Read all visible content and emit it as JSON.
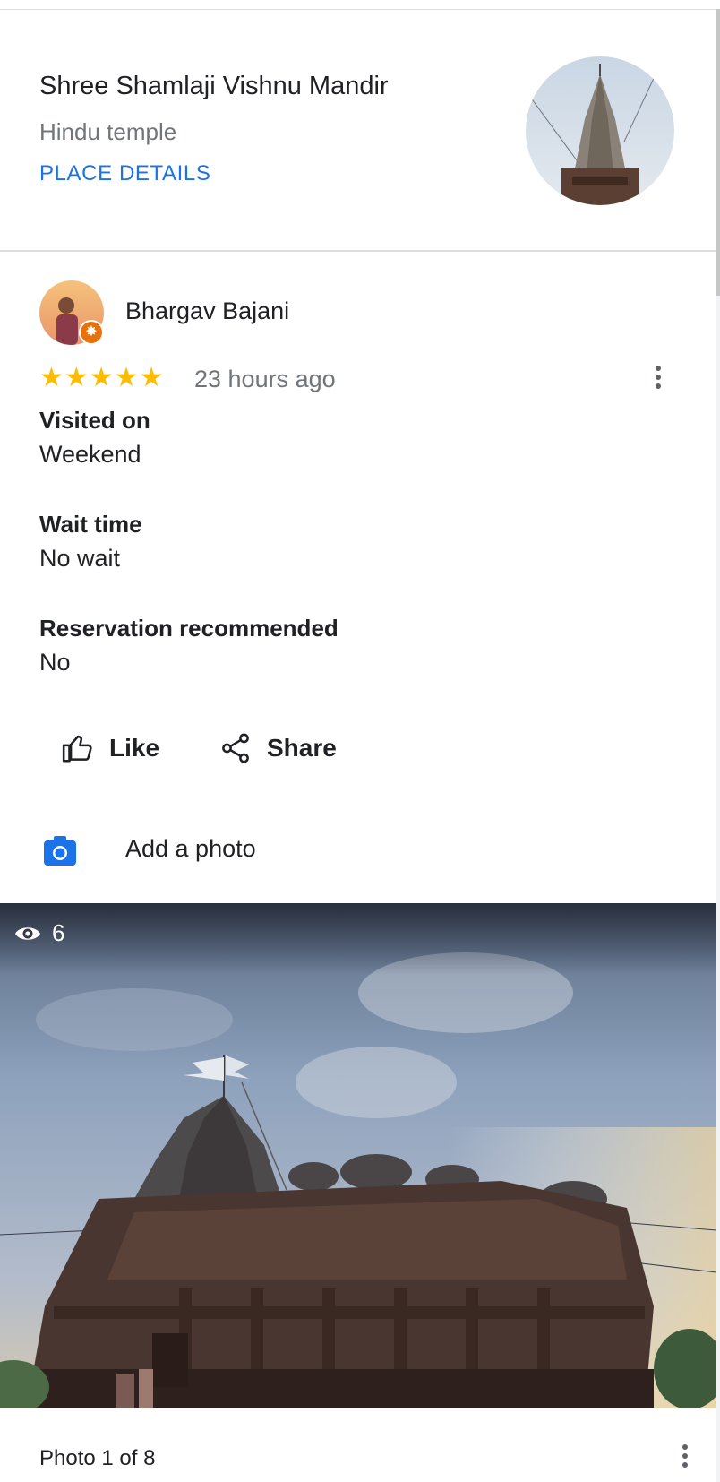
{
  "place": {
    "name": "Shree Shamlaji Vishnu Mandir",
    "category": "Hindu temple",
    "details_link": "PLACE DETAILS"
  },
  "review": {
    "reviewer_name": "Bhargav Bajani",
    "rating": 5,
    "stars_text": "★★★★★",
    "time_ago": "23 hours ago",
    "attributes": [
      {
        "label": "Visited on",
        "value": "Weekend"
      },
      {
        "label": "Wait time",
        "value": "No wait"
      },
      {
        "label": "Reservation recommended",
        "value": "No"
      }
    ]
  },
  "actions": {
    "like": "Like",
    "share": "Share",
    "add_photo": "Add a photo"
  },
  "photo": {
    "views": "6",
    "counter": "Photo 1 of 8"
  },
  "icons": {
    "like": "thumb-up-icon",
    "share": "share-icon",
    "camera": "camera-icon",
    "views": "eye-icon",
    "more": "more-vert-icon",
    "badge": "local-guide-badge"
  },
  "colors": {
    "accent": "#1a73e8",
    "star": "#fbbc04",
    "badge": "#e8710a",
    "secondary_text": "#70757a"
  }
}
